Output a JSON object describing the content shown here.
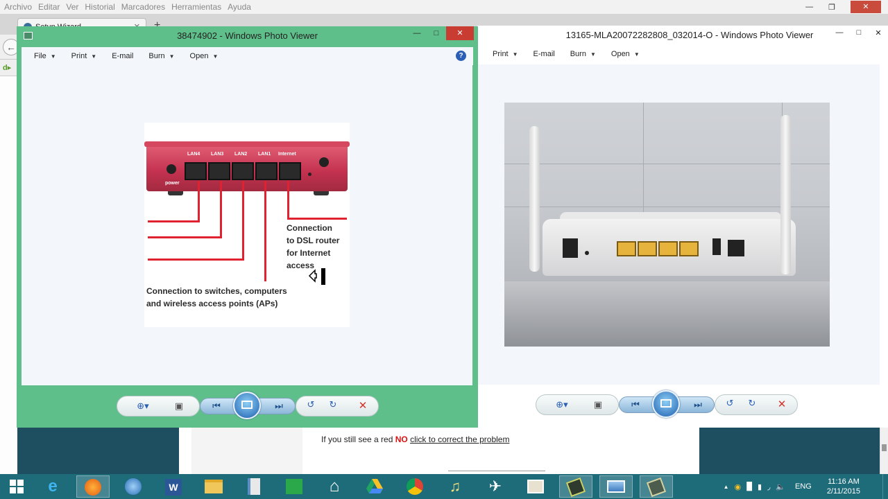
{
  "firefox": {
    "menu": [
      "Archivo",
      "Editar",
      "Ver",
      "Historial",
      "Marcadores",
      "Herramientas",
      "Ayuda"
    ],
    "tab_title": "Setup Wizard",
    "new_tab": "+",
    "bookmark_logo": "d▸"
  },
  "wizard": {
    "msg_prefix": "If you still see a red ",
    "msg_no": "NO",
    "link": "click to correct the problem"
  },
  "viewer_left": {
    "title": "38474902 - Windows Photo Viewer",
    "menu": [
      "File",
      "Print",
      "E-mail",
      "Burn",
      "Open"
    ]
  },
  "viewer_right": {
    "title": "13165-MLA20072282808_032014-O - Windows Photo Viewer",
    "menu": [
      "Print",
      "E-mail",
      "Burn",
      "Open"
    ]
  },
  "diagram": {
    "ports": [
      "LAN4",
      "LAN3",
      "LAN2",
      "LAN1",
      "Internet"
    ],
    "power": "power",
    "label_right": [
      "Connection",
      "to DSL router",
      "for Internet",
      "access"
    ],
    "label_bottom": [
      "Connection to switches, computers",
      "and wireless access points (APs)"
    ]
  },
  "colors": {
    "viewer_frame_active": "#5fbf8a",
    "viewer_frame_inactive": "#ffffff",
    "router_red": "#c43250",
    "cable_red": "#e0212f",
    "taskbar": "#1e6b7a"
  },
  "icons": {
    "zoom": "magnifier-icon",
    "fit": "actual-size-icon",
    "prev": "previous-icon",
    "slideshow": "slideshow-icon",
    "next": "next-icon",
    "rotate_ccw": "rotate-counterclockwise-icon",
    "rotate_cw": "rotate-clockwise-icon",
    "delete": "delete-icon"
  },
  "taskbar": {
    "apps": [
      "start",
      "internet-explorer",
      "firefox",
      "windows-media",
      "word",
      "file-explorer",
      "notepad",
      "store",
      "home",
      "google-drive",
      "chrome",
      "music",
      "plane",
      "photo-app",
      "cmd",
      "photo-viewer",
      "paint"
    ],
    "language": "ENG",
    "time": "11:16 AM",
    "date": "2/11/2015"
  }
}
